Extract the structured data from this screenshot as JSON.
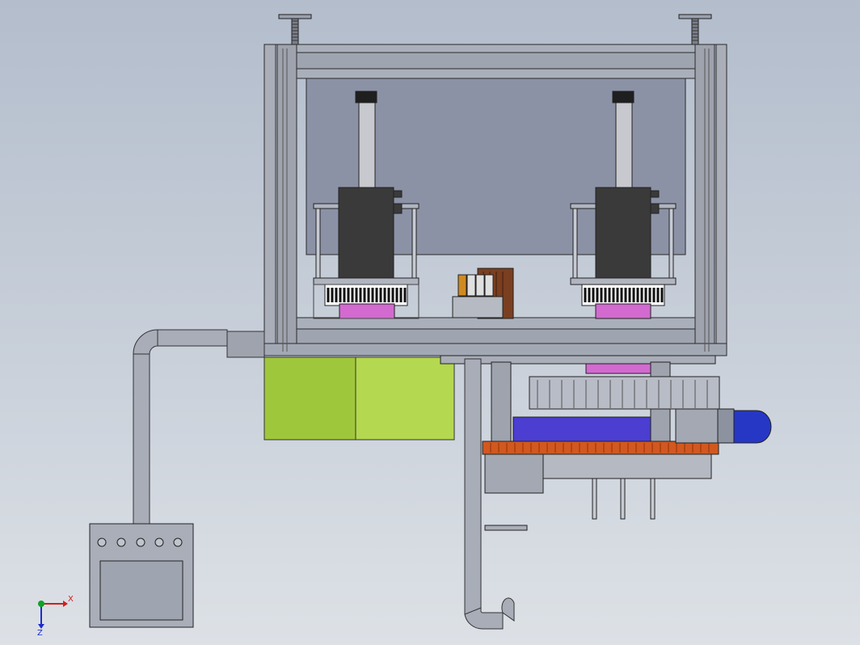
{
  "viewport": {
    "background_top": "#b3bdcc",
    "background_bottom": "#dde1e6"
  },
  "colors": {
    "frame": "#a9aeb9",
    "frame_edge": "#2a2a2a",
    "panel": "#8c92a6",
    "motor_body": "#3a3a3a",
    "spindle": "#c7c9cf",
    "magenta_part": "#d26ad0",
    "green_drum": "#9fc73c",
    "blue_plate": "#4b3ed0",
    "orange_plate": "#d2581f",
    "blue_motor": "#2637c6",
    "bronze_block": "#7a3f20",
    "pipe": "#a8adb8"
  },
  "triad": {
    "x_label": "X",
    "z_label": "Z",
    "x_color": "#d11e1e",
    "y_color": "#12a12a",
    "z_color": "#1e2bd0"
  }
}
